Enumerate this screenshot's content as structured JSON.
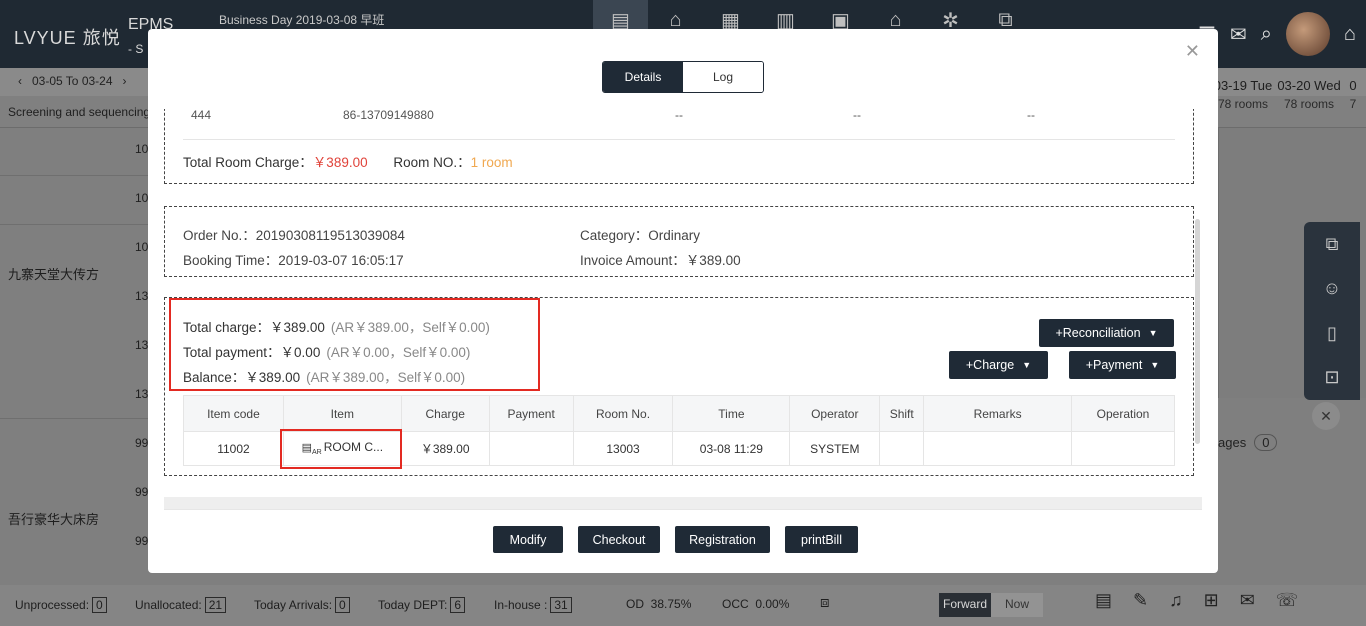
{
  "app": {
    "brand": "LVYUE 旅悦",
    "product": "EPMS",
    "product_sub": "- S",
    "business_day": "Business Day 2019-03-08 早班"
  },
  "nav_icons": [
    "front-desk-icon",
    "home-icon",
    "document-icon",
    "calendar-in-icon",
    "calendar-chart-icon",
    "house-icon",
    "atom-icon",
    "line-chart-icon"
  ],
  "datebar": {
    "range": "03-05 To 03-24",
    "screening": "Screening and sequencing",
    "days": [
      {
        "label": "03-19 Tue",
        "rooms": "78 rooms"
      },
      {
        "label": "03-20 Wed",
        "rooms": "78 rooms"
      },
      {
        "label": "0",
        "rooms": "7"
      }
    ]
  },
  "grid": {
    "room_type_1": "九寨天堂大传方",
    "room_type_2": "吾行豪华大床房",
    "rows_1": [
      "10",
      "10",
      "10",
      "13",
      "13",
      "13"
    ],
    "rows_2": [
      "99",
      "99",
      "99"
    ]
  },
  "right": {
    "messages_label": "ages",
    "messages_count": "0"
  },
  "status": {
    "unprocessed_label": "Unprocessed:",
    "unprocessed": "0",
    "unallocated_label": "Unallocated:",
    "unallocated": "21",
    "arrivals_label": "Today Arrivals:",
    "arrivals": "0",
    "dept_label": "Today DEPT:",
    "dept": "6",
    "inhouse_label": "In-house :",
    "inhouse": "31",
    "od_label": "OD",
    "od": "38.75%",
    "occ_label": "OCC",
    "occ": "0.00%",
    "forward": "Forward",
    "now": "Now"
  },
  "modal": {
    "tabs": {
      "details": "Details",
      "log": "Log"
    },
    "guest_row": {
      "name": "444",
      "phone": "86-13709149880",
      "c3": "--",
      "c4": "--",
      "c5": "--"
    },
    "total_room_charge_label": "Total Room Charge：",
    "total_room_charge": "￥389.00",
    "room_no_label": "Room NO.：",
    "room_no": "1 room",
    "order": {
      "order_no_label": "Order No.：",
      "order_no": "20190308119513039084",
      "category_label": "Category：",
      "category": "Ordinary",
      "booking_time_label": "Booking Time：",
      "booking_time": "2019-03-07 16:05:17",
      "invoice_label": "Invoice Amount：",
      "invoice": "￥389.00"
    },
    "summary": {
      "total_charge_label": "Total charge：",
      "total_charge": "￥389.00",
      "total_charge_detail": "(AR￥389.00，Self￥0.00)",
      "total_payment_label": "Total payment：",
      "total_payment": "￥0.00",
      "total_payment_detail": "(AR￥0.00，Self￥0.00)",
      "balance_label": "Balance：",
      "balance": "￥389.00",
      "balance_detail": "(AR￥389.00，Self￥0.00)"
    },
    "buttons": {
      "reconciliation": "+Reconciliation",
      "charge": "+Charge",
      "payment": "+Payment"
    },
    "table": {
      "headers": [
        "Item code",
        "Item",
        "Charge",
        "Payment",
        "Room No.",
        "Time",
        "Operator",
        "Shift",
        "Remarks",
        "Operation"
      ],
      "rows": [
        {
          "code": "11002",
          "item": "ROOM C...",
          "charge": "￥389.00",
          "payment": "",
          "room": "13003",
          "time": "03-08 11:29",
          "operator": "SYSTEM",
          "shift": "",
          "remarks": "",
          "operation": ""
        }
      ]
    },
    "footer": {
      "modify": "Modify",
      "checkout": "Checkout",
      "registration": "Registration",
      "print": "printBill"
    }
  },
  "colors": {
    "dark": "#1f2a36",
    "red": "#e32a22",
    "price_red": "#e0433a",
    "orange": "#f0a850"
  }
}
